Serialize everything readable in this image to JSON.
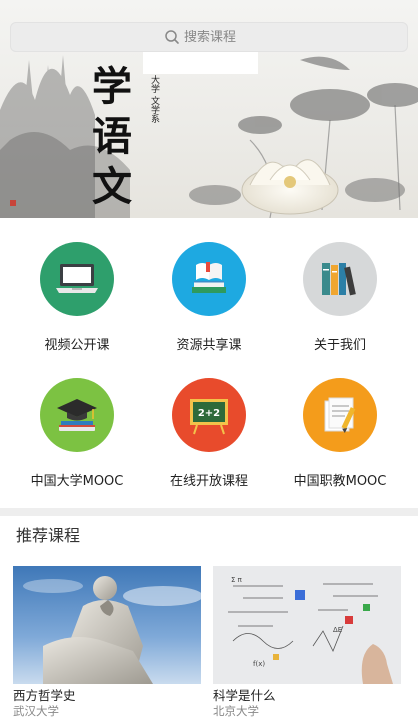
{
  "search": {
    "placeholder": "搜索课程",
    "icon": "search-icon"
  },
  "banner": {
    "calligraphy": [
      "学",
      "语",
      "文"
    ],
    "seal_text": [
      "大学",
      "文学系"
    ]
  },
  "categories": [
    {
      "label": "视频公开课",
      "icon": "laptop-icon",
      "color": "#2e9f6c"
    },
    {
      "label": "资源共享课",
      "icon": "books-icon",
      "color": "#1ea9e1"
    },
    {
      "label": "关于我们",
      "icon": "bookshelf-icon",
      "color": "#d6d8d9"
    },
    {
      "label": "中国大学MOOC",
      "icon": "graduation-cap-icon",
      "color": "#7cc242"
    },
    {
      "label": "在线开放课程",
      "icon": "blackboard-icon",
      "color": "#e84b2c"
    },
    {
      "label": "中国职教MOOC",
      "icon": "notepad-icon",
      "color": "#f49c1b"
    }
  ],
  "recommended": {
    "title": "推荐课程",
    "courses": [
      {
        "name": "西方哲学史",
        "school": "武汉大学"
      },
      {
        "name": "科学是什么",
        "school": "北京大学"
      }
    ]
  }
}
